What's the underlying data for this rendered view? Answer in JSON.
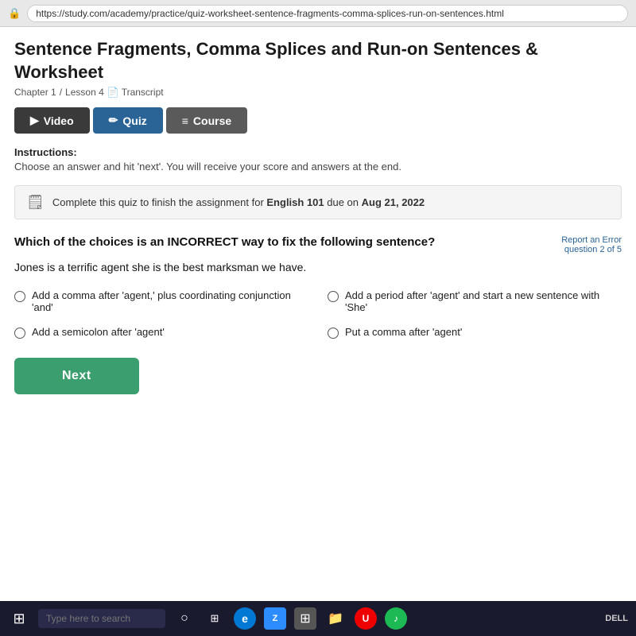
{
  "browser": {
    "url": "https://study.com/academy/practice/quiz-worksheet-sentence-fragments-comma-splices-run-on-sentences.html",
    "lock_icon": "🔒"
  },
  "page": {
    "title": "Sentence Fragments, Comma Splices and Run-on Sentences & Worksheet",
    "breadcrumb": {
      "chapter": "Chapter 1",
      "separator": "/",
      "lesson": "Lesson 4",
      "transcript_label": "Transcript"
    },
    "tabs": [
      {
        "id": "video",
        "label": "Video",
        "icon": "▶"
      },
      {
        "id": "quiz",
        "label": "Quiz",
        "icon": "✏"
      },
      {
        "id": "course",
        "label": "Course",
        "icon": "≡"
      }
    ],
    "instructions": {
      "label": "Instructions:",
      "text": "Choose an answer and hit 'next'. You will receive your score and answers at the end."
    },
    "assignment_notice": {
      "icon": "🗒",
      "text_prefix": "Complete this quiz to finish the assignment for ",
      "course_bold": "English 101",
      "text_middle": " due on ",
      "date_bold": "Aug 21, 2022"
    },
    "question": {
      "text": "Which of the choices is an INCORRECT way to fix the following sentence?",
      "report_error": "Report an Error",
      "question_count": "question 2 of 5",
      "sentence": "Jones is a terrific agent she is the best marksman we have.",
      "answers": [
        {
          "id": "a",
          "text": "Add a comma after 'agent,' plus coordinating conjunction 'and'"
        },
        {
          "id": "b",
          "text": "Add a period after 'agent' and start a new sentence with 'She'"
        },
        {
          "id": "c",
          "text": "Add a semicolon after 'agent'"
        },
        {
          "id": "d",
          "text": "Put a comma after 'agent'"
        }
      ]
    },
    "next_button_label": "Next"
  },
  "taskbar": {
    "search_placeholder": "Type here to search"
  }
}
